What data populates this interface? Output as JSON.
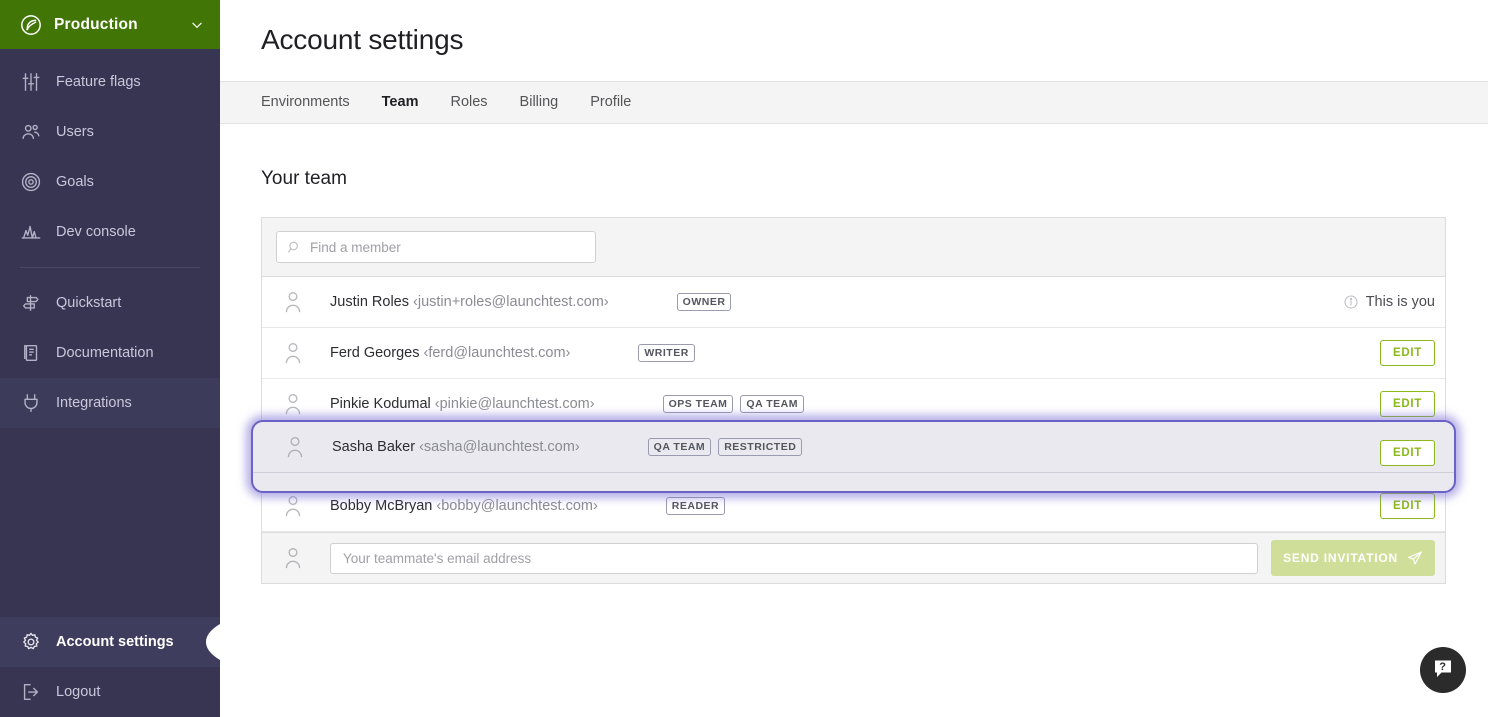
{
  "sidebar": {
    "environment": {
      "name": "Production",
      "logo_icon": "leaf-icon",
      "chevron_icon": "chevron-down-icon",
      "bg_color": "#417505"
    },
    "items": [
      {
        "label": "Feature flags",
        "icon": "sliders-icon"
      },
      {
        "label": "Users",
        "icon": "users-icon"
      },
      {
        "label": "Goals",
        "icon": "target-icon"
      },
      {
        "label": "Dev console",
        "icon": "chart-icon"
      }
    ],
    "items2": [
      {
        "label": "Quickstart",
        "icon": "signpost-icon"
      },
      {
        "label": "Documentation",
        "icon": "book-icon"
      },
      {
        "label": "Integrations",
        "icon": "plug-icon"
      }
    ],
    "bottom": [
      {
        "label": "Account settings",
        "icon": "gear-icon",
        "active": true
      },
      {
        "label": "Logout",
        "icon": "logout-icon",
        "active": false
      }
    ],
    "collapse_icon": "chevron-left-icon",
    "bg_color": "#373552"
  },
  "header": {
    "title": "Account settings"
  },
  "tabs": [
    {
      "label": "Environments",
      "active": false
    },
    {
      "label": "Team",
      "active": true
    },
    {
      "label": "Roles",
      "active": false
    },
    {
      "label": "Billing",
      "active": false
    },
    {
      "label": "Profile",
      "active": false
    }
  ],
  "section": {
    "title": "Your team"
  },
  "search": {
    "placeholder": "Find a member",
    "value": "",
    "icon": "search-icon"
  },
  "members": [
    {
      "name": "Justin Roles",
      "email": "‹justin+roles@launchtest.com›",
      "badges": [
        "OWNER"
      ],
      "action": "this-is-you",
      "action_label": "This is you",
      "selected": false
    },
    {
      "name": "Ferd Georges",
      "email": "‹ferd@launchtest.com›",
      "badges": [
        "WRITER"
      ],
      "action": "edit",
      "action_label": "EDIT",
      "selected": false
    },
    {
      "name": "Pinkie Kodumal",
      "email": "‹pinkie@launchtest.com›",
      "badges": [
        "OPS TEAM",
        "QA TEAM"
      ],
      "action": "edit",
      "action_label": "EDIT",
      "selected": false
    },
    {
      "name": "Sasha Baker",
      "email": "‹sasha@launchtest.com›",
      "badges": [
        "QA TEAM",
        "RESTRICTED"
      ],
      "action": "edit",
      "action_label": "EDIT",
      "selected": true
    },
    {
      "name": "Bobby McBryan",
      "email": "‹bobby@launchtest.com›",
      "badges": [
        "READER"
      ],
      "action": "edit",
      "action_label": "EDIT",
      "selected": false
    }
  ],
  "invite": {
    "placeholder": "Your teammate's email address",
    "value": "",
    "button_label": "SEND INVITATION",
    "button_icon": "paper-plane-icon",
    "button_color": "#cfdf9a",
    "avatar_icon": "person-icon"
  },
  "help": {
    "icon": "question-bubble-icon",
    "bg_color": "#2b2b2b"
  },
  "colors": {
    "accent_green": "#8cb91a",
    "sidebar": "#373552",
    "focus_ring": "#6a62c6"
  }
}
